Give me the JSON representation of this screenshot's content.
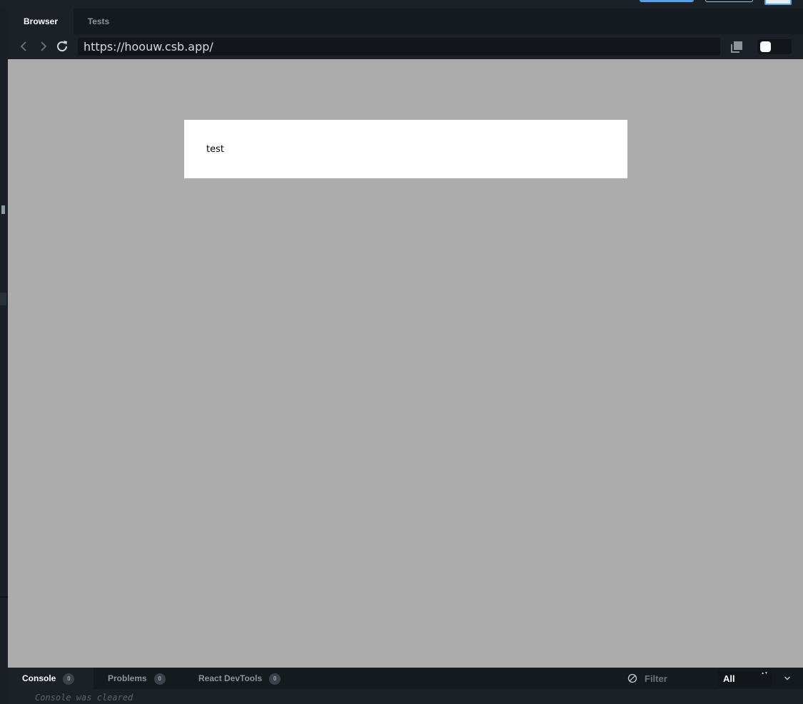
{
  "browser_tabs": {
    "browser": "Browser",
    "tests": "Tests"
  },
  "address_bar": {
    "url": "https://hoouw.csb.app/"
  },
  "preview": {
    "card_text": "test"
  },
  "console_panel": {
    "tabs": [
      {
        "label": "Console",
        "count": "0"
      },
      {
        "label": "Problems",
        "count": "0"
      },
      {
        "label": "React DevTools",
        "count": "0"
      }
    ],
    "filter_placeholder": "Filter",
    "level_selected": "All",
    "log_message": "Console was cleared"
  },
  "colors": {
    "panel_dark": "#1c2127",
    "panel_darker": "#151a1e",
    "viewport_bg": "#acacac",
    "accent": "#4aa3f5"
  },
  "icons": [
    "back-arrow-icon",
    "forward-arrow-icon",
    "reload-icon",
    "copy-icon",
    "clear-icon",
    "chevron-down-icon"
  ]
}
